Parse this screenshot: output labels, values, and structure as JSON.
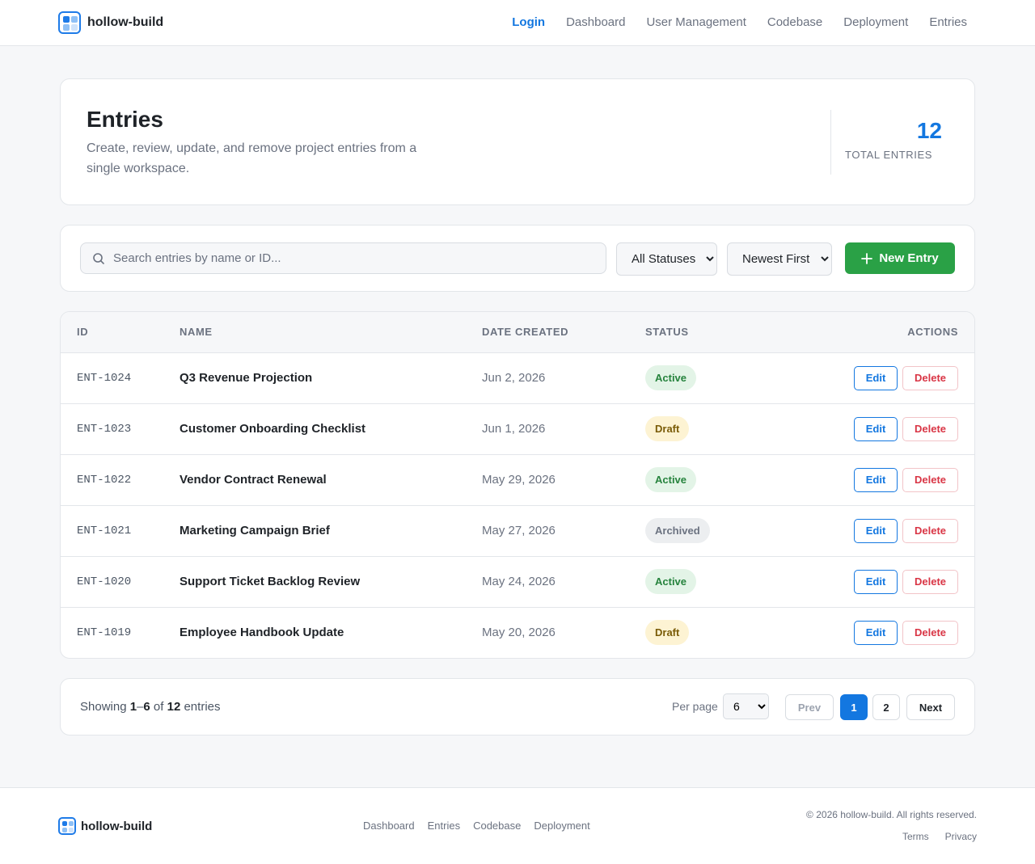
{
  "app": {
    "name": "hollow-build"
  },
  "nav": {
    "items": [
      {
        "label": "Login",
        "active": true
      },
      {
        "label": "Dashboard"
      },
      {
        "label": "User Management"
      },
      {
        "label": "Codebase"
      },
      {
        "label": "Deployment"
      },
      {
        "label": "Entries"
      }
    ]
  },
  "hero": {
    "title": "Entries",
    "description": "Create, review, update, and remove project entries from a single workspace.",
    "total_count": "12",
    "total_label": "TOTAL ENTRIES"
  },
  "toolbar": {
    "search_placeholder": "Search entries by name or ID...",
    "status_filter": "All Statuses",
    "sort": "Newest First",
    "new_button": "New Entry"
  },
  "table": {
    "headers": [
      "ID",
      "NAME",
      "DATE CREATED",
      "STATUS",
      "ACTIONS"
    ],
    "edit_label": "Edit",
    "delete_label": "Delete",
    "rows": [
      {
        "id": "ENT-1024",
        "name": "Q3 Revenue Projection",
        "date": "Jun 2, 2026",
        "status": "Active"
      },
      {
        "id": "ENT-1023",
        "name": "Customer Onboarding Checklist",
        "date": "Jun 1, 2026",
        "status": "Draft"
      },
      {
        "id": "ENT-1022",
        "name": "Vendor Contract Renewal",
        "date": "May 29, 2026",
        "status": "Active"
      },
      {
        "id": "ENT-1021",
        "name": "Marketing Campaign Brief",
        "date": "May 27, 2026",
        "status": "Archived"
      },
      {
        "id": "ENT-1020",
        "name": "Support Ticket Backlog Review",
        "date": "May 24, 2026",
        "status": "Active"
      },
      {
        "id": "ENT-1019",
        "name": "Employee Handbook Update",
        "date": "May 20, 2026",
        "status": "Draft"
      }
    ]
  },
  "pagination": {
    "showing_prefix": "Showing",
    "range_start": "1",
    "range_end": "6",
    "of_text": "of",
    "total": "12",
    "suffix": "entries",
    "per_page_label": "Per page",
    "per_page_value": "6",
    "prev_label": "Prev",
    "pages": [
      "1",
      "2"
    ],
    "current_page": "1",
    "next_label": "Next"
  },
  "footer": {
    "brand": "hollow-build",
    "links": [
      "Dashboard",
      "Entries",
      "Codebase",
      "Deployment"
    ],
    "copyright": "© 2026 hollow-build. All rights reserved.",
    "legal": [
      "Terms",
      "Privacy"
    ]
  },
  "colors": {
    "accent": "#1377e0",
    "success": "#2aa146",
    "danger": "#d93545",
    "background": "#f6f7f9"
  }
}
